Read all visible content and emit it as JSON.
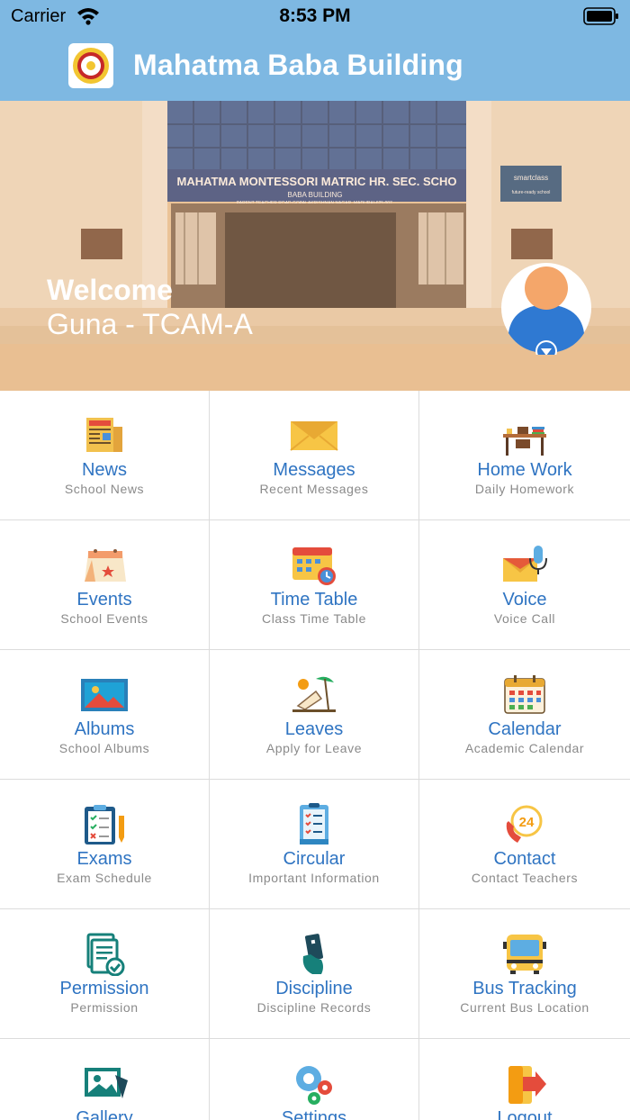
{
  "status_bar": {
    "carrier": "Carrier",
    "time": "8:53 PM"
  },
  "nav": {
    "title": "Mahatma Baba Building"
  },
  "hero": {
    "welcome": "Welcome",
    "user": "Guna - TCAM-A",
    "school_sign": "MAHATMA MONTESSORI MATRIC HR. SEC. SCHO",
    "building_sign": "BABA BUILDING",
    "address_sign": "PARENT TEACHER ROAD,GOPALAKRISHNAN NAGAR, MADURAI-625 007.",
    "side_sign": "smartclass",
    "side_sign_sub": "future-ready school"
  },
  "menu": [
    {
      "label": "News",
      "sub": "School News",
      "icon": "newspaper-icon"
    },
    {
      "label": "Messages",
      "sub": "Recent Messages",
      "icon": "envelope-icon"
    },
    {
      "label": "Home Work",
      "sub": "Daily Homework",
      "icon": "desk-icon"
    },
    {
      "label": "Events",
      "sub": "School Events",
      "icon": "event-calendar-icon"
    },
    {
      "label": "Time Table",
      "sub": "Class Time Table",
      "icon": "timetable-icon"
    },
    {
      "label": "Voice",
      "sub": "Voice Call",
      "icon": "voice-mail-icon"
    },
    {
      "label": "Albums",
      "sub": "School Albums",
      "icon": "picture-icon"
    },
    {
      "label": "Leaves",
      "sub": "Apply for Leave",
      "icon": "beach-chair-icon"
    },
    {
      "label": "Calendar",
      "sub": "Academic Calendar",
      "icon": "calendar-icon"
    },
    {
      "label": "Exams",
      "sub": "Exam Schedule",
      "icon": "exam-clipboard-icon"
    },
    {
      "label": "Circular",
      "sub": "Important Information",
      "icon": "checklist-icon"
    },
    {
      "label": "Contact",
      "sub": "Contact Teachers",
      "icon": "phone-24-icon"
    },
    {
      "label": "Permission",
      "sub": "Permission",
      "icon": "permission-document-icon"
    },
    {
      "label": "Discipline",
      "sub": "Discipline Records",
      "icon": "hand-card-icon"
    },
    {
      "label": "Bus Tracking",
      "sub": "Current Bus Location",
      "icon": "bus-icon"
    },
    {
      "label": "Gallery",
      "sub": "",
      "icon": "gallery-icon"
    },
    {
      "label": "Settings",
      "sub": "",
      "icon": "gears-icon"
    },
    {
      "label": "Logout",
      "sub": "",
      "icon": "logout-icon"
    }
  ]
}
